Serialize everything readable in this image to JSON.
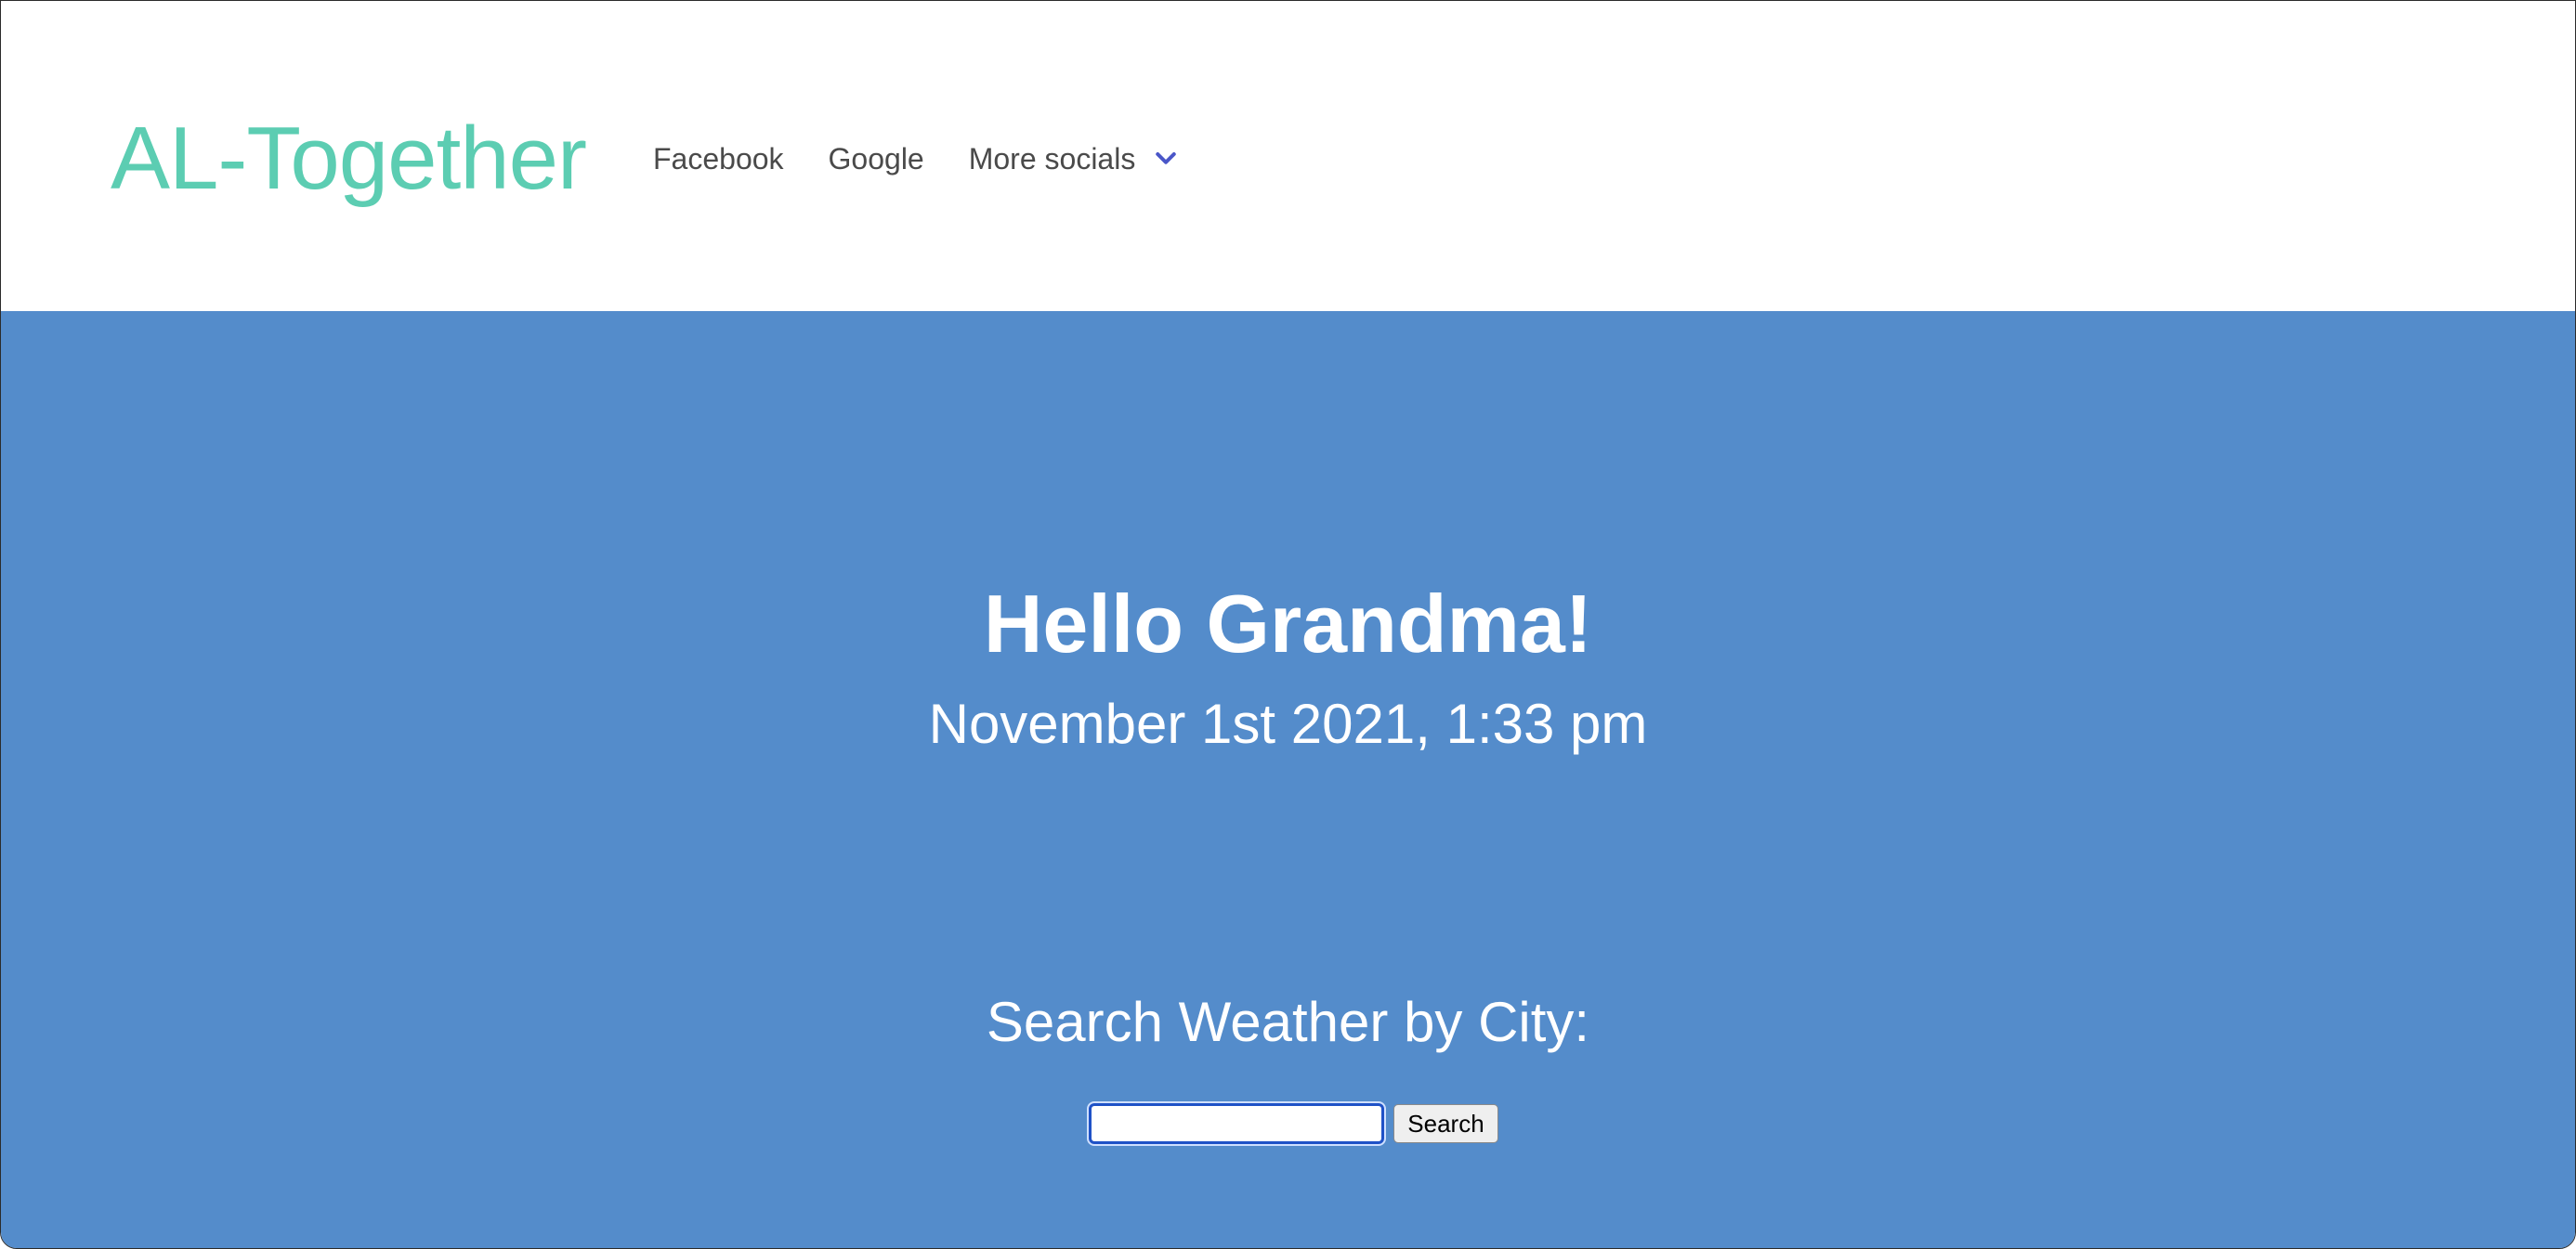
{
  "header": {
    "brand": "AL-Together",
    "nav": [
      {
        "label": "Facebook"
      },
      {
        "label": "Google"
      },
      {
        "label": "More socials"
      }
    ]
  },
  "hero": {
    "title": "Hello Grandma!",
    "datetime": "November 1st 2021, 1:33 pm"
  },
  "search": {
    "label": "Search Weather by City:",
    "input_value": "",
    "placeholder": "",
    "button_label": "Search"
  },
  "colors": {
    "brand": "#5ccdb2",
    "hero_background": "#548ccb",
    "chevron": "#4a56c8"
  },
  "icons": {
    "dropdown": "chevron-down-icon"
  }
}
